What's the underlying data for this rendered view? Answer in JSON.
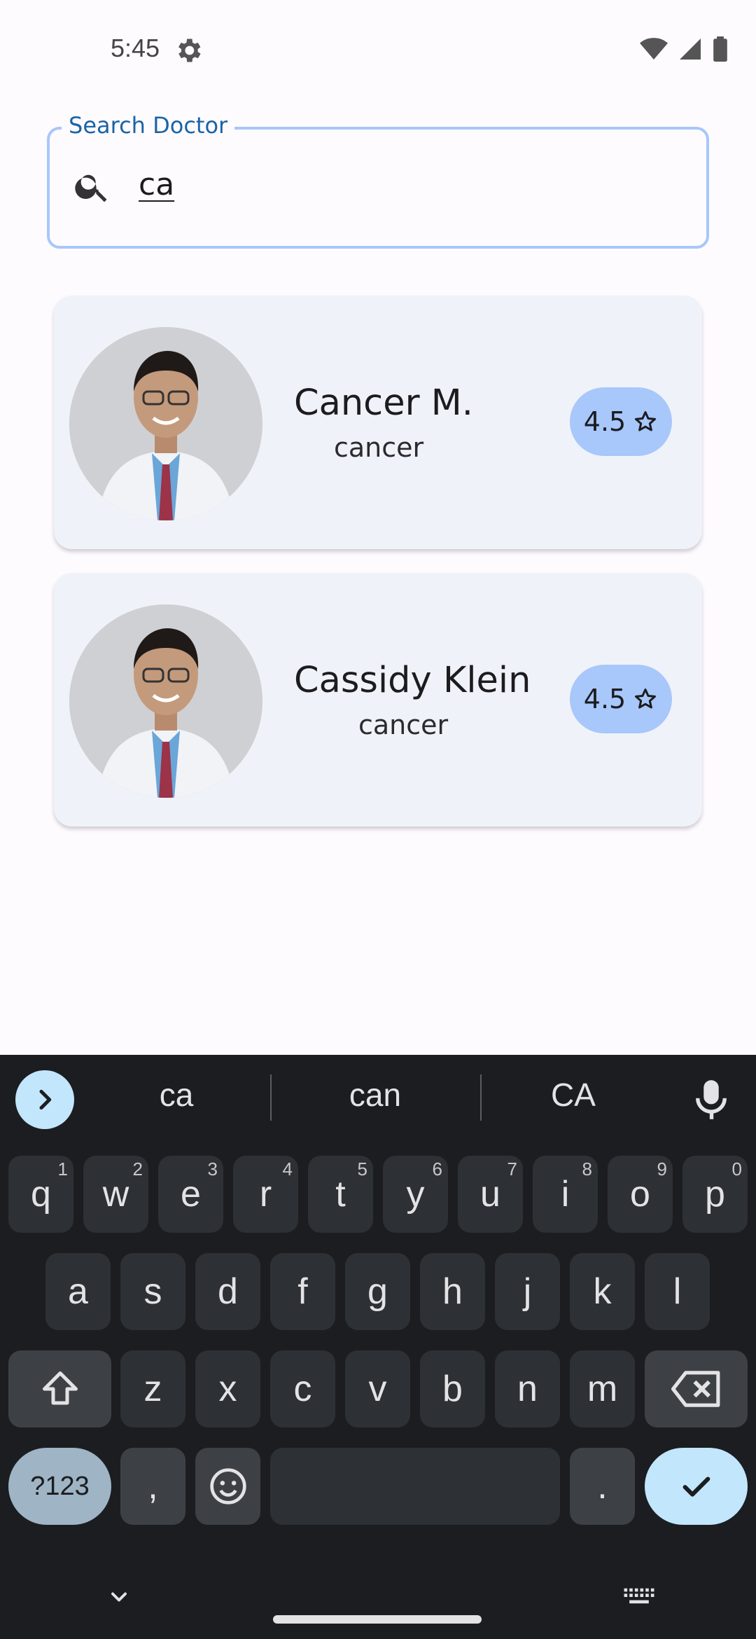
{
  "status": {
    "time": "5:45"
  },
  "search": {
    "label": "Search Doctor",
    "value": "ca"
  },
  "doctors": [
    {
      "name": "Cancer M.",
      "specialty": "cancer",
      "rating": "4.5"
    },
    {
      "name": "Cassidy Klein",
      "specialty": "cancer",
      "rating": "4.5"
    }
  ],
  "keyboard": {
    "suggestions": [
      "ca",
      "can",
      "CA"
    ],
    "row1": [
      {
        "k": "q",
        "h": "1"
      },
      {
        "k": "w",
        "h": "2"
      },
      {
        "k": "e",
        "h": "3"
      },
      {
        "k": "r",
        "h": "4"
      },
      {
        "k": "t",
        "h": "5"
      },
      {
        "k": "y",
        "h": "6"
      },
      {
        "k": "u",
        "h": "7"
      },
      {
        "k": "i",
        "h": "8"
      },
      {
        "k": "o",
        "h": "9"
      },
      {
        "k": "p",
        "h": "0"
      }
    ],
    "row2": [
      "a",
      "s",
      "d",
      "f",
      "g",
      "h",
      "j",
      "k",
      "l"
    ],
    "row3": [
      "z",
      "x",
      "c",
      "v",
      "b",
      "n",
      "m"
    ],
    "symbols_label": "?123",
    "comma": ",",
    "period": "."
  }
}
